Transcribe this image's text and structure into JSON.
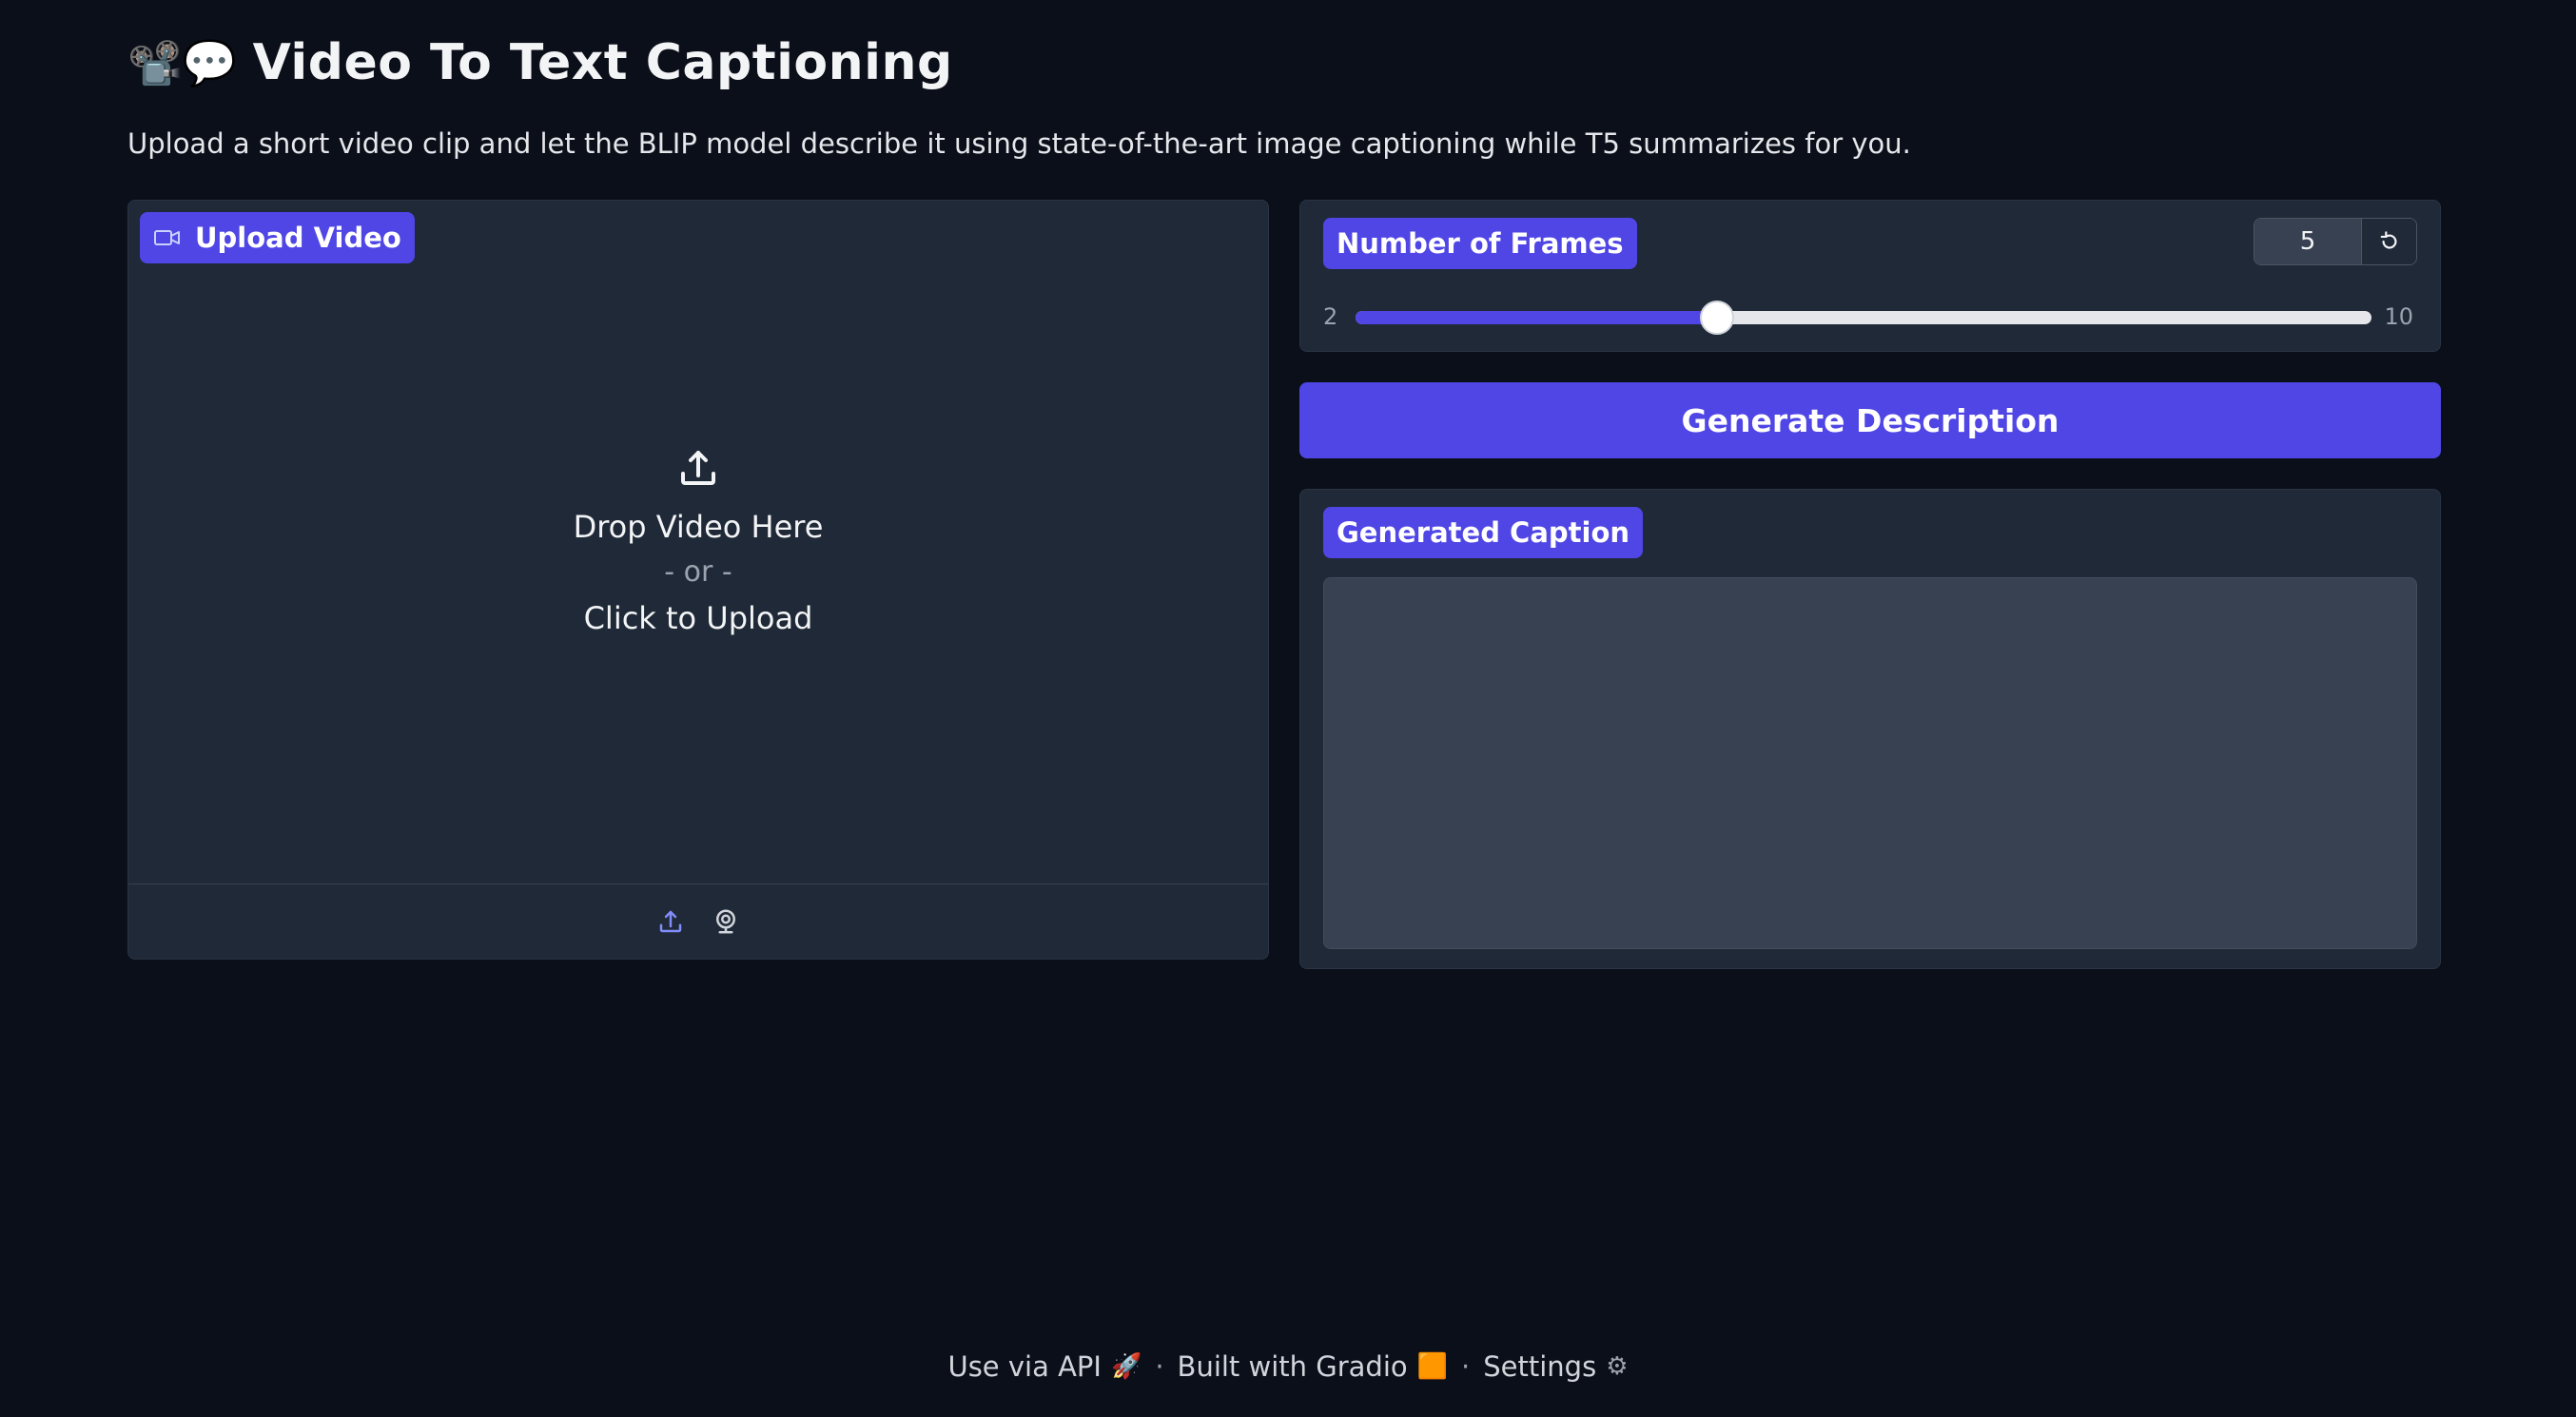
{
  "header": {
    "emoji": "📽️💬",
    "title": "Video To Text Captioning",
    "subtitle": "Upload a short video clip and let the BLIP model describe it using state-of-the-art image captioning while T5 summarizes for you."
  },
  "upload": {
    "label": "Upload Video",
    "drop_text": "Drop Video Here",
    "or_text": "- or -",
    "click_text": "Click to Upload",
    "sources": [
      "upload-icon",
      "webcam-icon"
    ]
  },
  "frames": {
    "label": "Number of Frames",
    "value": "5",
    "min": "2",
    "max": "10"
  },
  "generate_button": "Generate Description",
  "caption": {
    "label": "Generated Caption",
    "value": ""
  },
  "footer": {
    "api": "Use via API",
    "api_icon": "🚀",
    "built": "Built with Gradio",
    "built_icon": "🟧",
    "settings": "Settings",
    "settings_icon": "⚙"
  },
  "colors": {
    "accent": "#4f46e5",
    "background": "#0b0f19",
    "panel": "#1f2937"
  }
}
